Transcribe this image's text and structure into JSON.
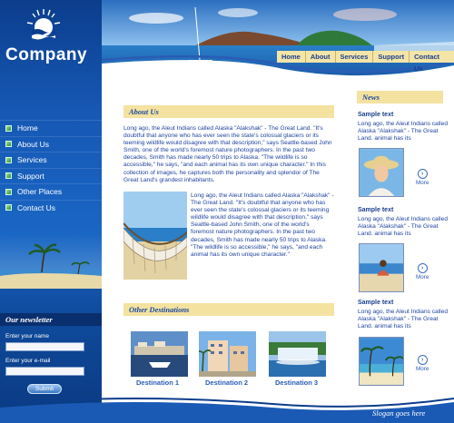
{
  "brand": {
    "name": "Company"
  },
  "top_nav": [
    "Home",
    "About",
    "Services",
    "Support",
    "Contact Us"
  ],
  "side_nav": [
    "Home",
    "About Us",
    "Services",
    "Support",
    "Other Places",
    "Contact Us"
  ],
  "about": {
    "heading": "About Us",
    "paragraph1": "Long ago, the Aleut Indians called Alaska \"Alakshak\" - The Great Land. \"It's doubtful that anyone who has ever seen the state's colossal glaciers or its teeming wildlife would disagree with that description,\" says Seattle-based John Smith, one of the world's foremost nature photographers. In the past two decades, Smith has made nearly 50 trips to Alaska. \"The wildlife is so accessible,\" he says, \"and each animal has its own unique character.\" In this collection of images, he captures both the personality and splendor of The Great Land's grandest inhabitants.",
    "paragraph2": "Long ago, the Aleut Indians called Alaska \"Alakshak\" - The Great Land. \"It's doubtful that anyone who has ever seen the state's colossal glaciers or its teeming wildlife would disagree with that description,\" says Seattle-based John Smith, one of the world's foremost nature photographers. In the past two decades, Smith has made nearly 50 trips to Alaska. \"The wildlife is so accessible,\" he says, \"and each animal has its own unique character.\""
  },
  "destinations": {
    "heading": "Other Destinations",
    "items": [
      "Destination 1",
      "Destination 2",
      "Destination 3"
    ]
  },
  "news": {
    "heading": "News",
    "items": [
      {
        "title": "Sample text",
        "text": "Long ago, the Aleut Indians called Alaska \"Alakshak\" - The Great Land.  animal has its",
        "more": "More"
      },
      {
        "title": "Sample text",
        "text": "Long ago, the Aleut Indians called Alaska \"Alakshak\" - The Great Land.  animal has its",
        "more": "More"
      },
      {
        "title": "Sample text",
        "text": "Long ago, the Aleut Indians called Alaska \"Alakshak\" - The Great Land.  animal has its",
        "more": "More"
      }
    ]
  },
  "newsletter": {
    "heading": "Our newsletter",
    "name_label": "Enter your name",
    "email_label": "Enter your e-mail",
    "submit_label": "Submit"
  },
  "footer": {
    "slogan": "Slogan goes here"
  }
}
